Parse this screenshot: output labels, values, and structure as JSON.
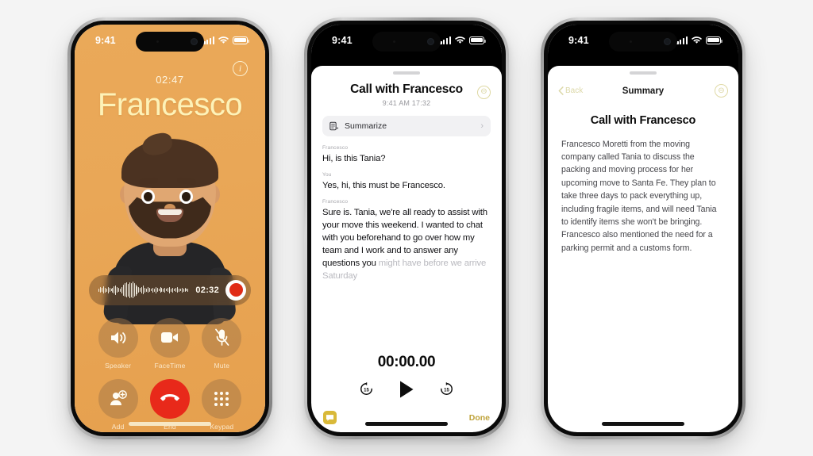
{
  "page": {
    "background": "#f4f4f4"
  },
  "phone1": {
    "name": "call-screen",
    "statusbar": {
      "time": "9:41",
      "cellular": "signal-bars",
      "wifi": "wifi",
      "battery": "battery-full"
    },
    "info_button": "i",
    "call_duration": "02:47",
    "caller_name": "Francesco",
    "accent": "#eaa959",
    "name_color": "#fdf2b8",
    "recording": {
      "time": "02:32",
      "record_button": "record-stop",
      "waveform": [
        4,
        7,
        5,
        9,
        6,
        4,
        8,
        5,
        3,
        6,
        9,
        12,
        7,
        5,
        4,
        8,
        14,
        17,
        19,
        16,
        20,
        18,
        21,
        17,
        14,
        10,
        7,
        5,
        8,
        11,
        6,
        4,
        7,
        5,
        3,
        6,
        4,
        8,
        5,
        3,
        7,
        5,
        4,
        6,
        3,
        5,
        8,
        4,
        6,
        3,
        5,
        7,
        4,
        3,
        6,
        4,
        5,
        3,
        4,
        6
      ]
    },
    "controls": [
      {
        "label": "Speaker",
        "icon": "speaker-icon",
        "style": "normal"
      },
      {
        "label": "FaceTime",
        "icon": "video-icon",
        "style": "normal"
      },
      {
        "label": "Mute",
        "icon": "mic-off-icon",
        "style": "normal"
      },
      {
        "label": "Add",
        "icon": "add-call-icon",
        "style": "normal"
      },
      {
        "label": "End",
        "icon": "end-call-icon",
        "style": "end"
      },
      {
        "label": "Keypad",
        "icon": "keypad-icon",
        "style": "normal"
      }
    ]
  },
  "phone2": {
    "name": "transcript-sheet",
    "statusbar": {
      "time": "9:41",
      "cellular": "signal-bars",
      "wifi": "wifi",
      "battery": "battery-full"
    },
    "title": "Call with Francesco",
    "subtitle": "9:41 AM  17:32",
    "badge": "⊖",
    "summarize": {
      "label": "Summarize",
      "icon": "summarize-doc-icon",
      "chevron": "›"
    },
    "transcript": [
      {
        "speaker": "Francesco",
        "text": "Hi, is this Tania?",
        "faded": false
      },
      {
        "speaker": "You",
        "text": "Yes, hi, this must be Francesco.",
        "faded": false
      },
      {
        "speaker": "Francesco",
        "text": "Sure is. Tania, we're all ready to assist with your move this weekend. I wanted to chat with you beforehand to go over how my team and I work and to answer any questions you ",
        "faded_tail": "might have before we arrive Saturday",
        "faded": true
      }
    ],
    "player": {
      "time": "00:00.00",
      "skip_back": "15",
      "play": "play-icon",
      "skip_forward": "15"
    },
    "footer": {
      "message_icon": "message-transcript-icon",
      "done_label": "Done"
    }
  },
  "phone3": {
    "name": "summary-screen",
    "statusbar": {
      "time": "9:41",
      "cellular": "signal-bars",
      "wifi": "wifi",
      "battery": "battery-full"
    },
    "back_label": "Back",
    "nav_title": "Summary",
    "badge": "⊖",
    "title": "Call with Francesco",
    "body": "Francesco Moretti from the moving company called Tania to discuss the packing and moving process for her upcoming move to Santa Fe. They plan to take three days to pack everything up, including fragile items, and will need Tania to identify items she won't be bringing. Francesco also mentioned the need for a parking permit and a customs form."
  }
}
